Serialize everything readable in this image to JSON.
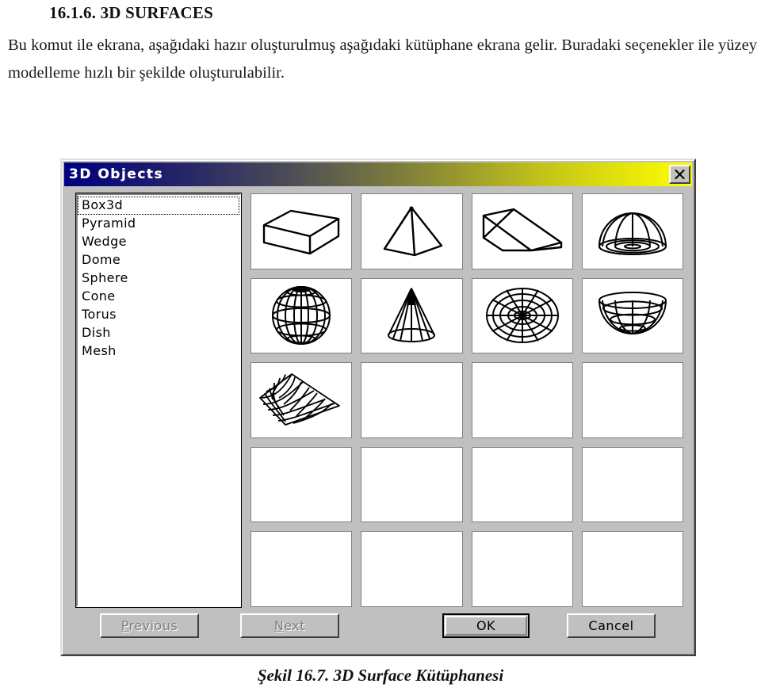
{
  "document": {
    "heading": "16.1.6. 3D SURFACES",
    "paragraph": "Bu komut ile ekrana, aşağıdaki hazır oluşturulmuş aşağıdaki kütüphane ekrana gelir. Buradaki seçenekler ile yüzey modelleme hızlı bir şekilde oluşturulabilir.",
    "caption": "Şekil 16.7. 3D Surface Kütüphanesi"
  },
  "dialog": {
    "title": "3D Objects",
    "close_label": "X",
    "close_icon": "close-icon",
    "titlebar_gradient_start": "#000080",
    "titlebar_gradient_end": "#ffff00",
    "face_color": "#c0c0c0",
    "list": {
      "items": [
        {
          "label": "Box3d",
          "selected": true
        },
        {
          "label": "Pyramid",
          "selected": false
        },
        {
          "label": "Wedge",
          "selected": false
        },
        {
          "label": "Dome",
          "selected": false
        },
        {
          "label": "Sphere",
          "selected": false
        },
        {
          "label": "Cone",
          "selected": false
        },
        {
          "label": "Torus",
          "selected": false
        },
        {
          "label": "Dish",
          "selected": false
        },
        {
          "label": "Mesh",
          "selected": false
        }
      ]
    },
    "grid": {
      "columns": 4,
      "rows": 5,
      "cells": [
        {
          "shape": "box3d",
          "empty": false
        },
        {
          "shape": "pyramid",
          "empty": false
        },
        {
          "shape": "wedge",
          "empty": false
        },
        {
          "shape": "dome",
          "empty": false
        },
        {
          "shape": "sphere",
          "empty": false
        },
        {
          "shape": "cone",
          "empty": false
        },
        {
          "shape": "torus",
          "empty": false
        },
        {
          "shape": "dish",
          "empty": false
        },
        {
          "shape": "mesh",
          "empty": false
        },
        {
          "shape": "",
          "empty": true
        },
        {
          "shape": "",
          "empty": true
        },
        {
          "shape": "",
          "empty": true
        },
        {
          "shape": "",
          "empty": true
        },
        {
          "shape": "",
          "empty": true
        },
        {
          "shape": "",
          "empty": true
        },
        {
          "shape": "",
          "empty": true
        },
        {
          "shape": "",
          "empty": true
        },
        {
          "shape": "",
          "empty": true
        },
        {
          "shape": "",
          "empty": true
        },
        {
          "shape": "",
          "empty": true
        }
      ]
    },
    "buttons": {
      "previous": {
        "label": "Previous",
        "mnemonic": "P",
        "disabled": true,
        "default": false
      },
      "next": {
        "label": "Next",
        "mnemonic": "N",
        "disabled": true,
        "default": false
      },
      "ok": {
        "label": "OK",
        "mnemonic": "",
        "disabled": false,
        "default": true
      },
      "cancel": {
        "label": "Cancel",
        "mnemonic": "",
        "disabled": false,
        "default": false
      }
    }
  }
}
